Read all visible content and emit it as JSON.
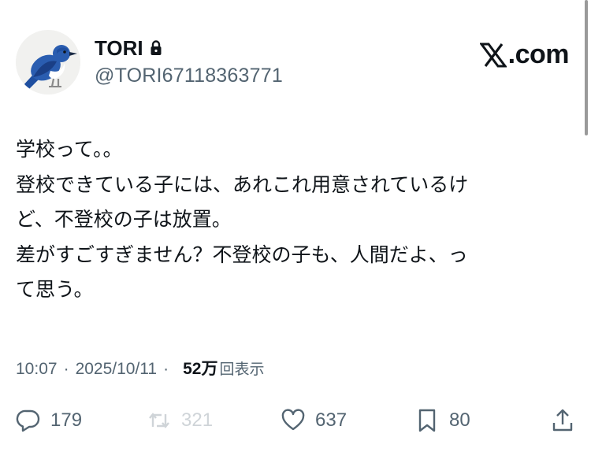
{
  "author": {
    "display_name": "TORI",
    "handle": "@TORI67118363771",
    "protected": true,
    "avatar_icon": "bluebird-avatar-icon",
    "lock_icon": "lock-icon"
  },
  "brand": {
    "text": ".com",
    "logo_icon": "x-logo-icon"
  },
  "tweet": {
    "text": "学校って。。\n登校できている子には、あれこれ用意されているけ\nど、不登校の子は放置。\n差がすごすぎません？不登校の子も、人間だよ、っ\nて思う。"
  },
  "meta": {
    "time": "10:07",
    "separator": "·",
    "date": "2025/10/11",
    "views_count": "52万",
    "views_label": "回表示"
  },
  "actions": {
    "reply": {
      "icon": "reply-icon",
      "count": "179"
    },
    "retweet": {
      "icon": "retweet-icon",
      "count": "321",
      "disabled": true
    },
    "like": {
      "icon": "heart-icon",
      "count": "637"
    },
    "bookmark": {
      "icon": "bookmark-icon",
      "count": "80"
    },
    "share": {
      "icon": "share-icon"
    }
  },
  "colors": {
    "text_primary": "#0f1419",
    "text_secondary": "#536471",
    "disabled": "#cfd4d8",
    "avatar_bird": "#2a5db0"
  }
}
